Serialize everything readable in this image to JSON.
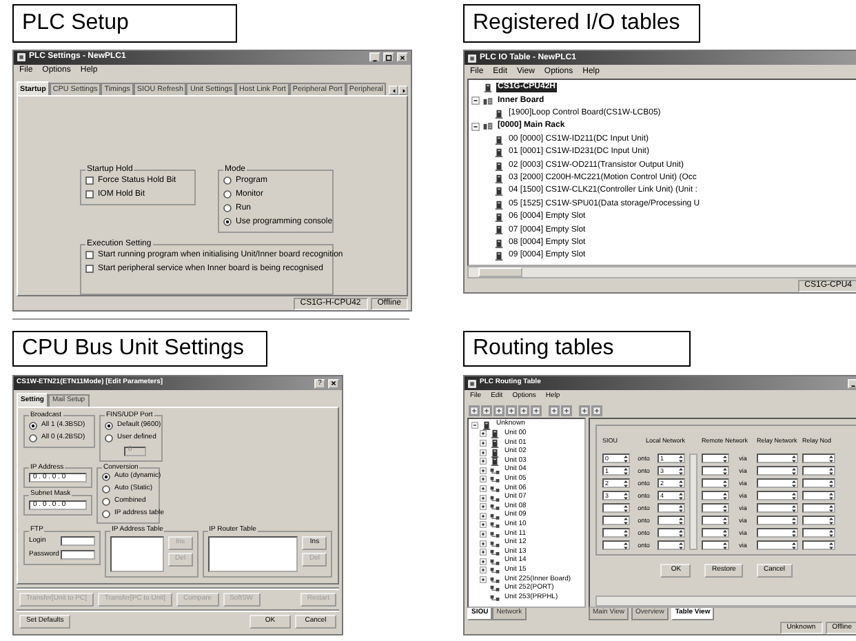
{
  "plc_setup": {
    "caption": "PLC Setup",
    "title": "PLC Settings - NewPLC1",
    "menu": [
      "File",
      "Options",
      "Help"
    ],
    "tabs": [
      {
        "label": "Startup",
        "selected": true
      },
      {
        "label": "CPU Settings",
        "selected": false
      },
      {
        "label": "Timings",
        "selected": false
      },
      {
        "label": "SIOU Refresh",
        "selected": false
      },
      {
        "label": "Unit Settings",
        "selected": false
      },
      {
        "label": "Host Link Port",
        "selected": false
      },
      {
        "label": "Peripheral Port",
        "selected": false
      },
      {
        "label": "Peripheral",
        "selected": false
      }
    ],
    "startup_hold": {
      "label": "Startup Hold",
      "items": [
        {
          "label": "Force Status Hold Bit",
          "checked": false
        },
        {
          "label": "IOM Hold Bit",
          "checked": false
        }
      ]
    },
    "mode": {
      "label": "Mode",
      "items": [
        {
          "label": "Program",
          "selected": false
        },
        {
          "label": "Monitor",
          "selected": false
        },
        {
          "label": "Run",
          "selected": false
        },
        {
          "label": "Use programming console",
          "selected": true
        }
      ]
    },
    "execution_setting": {
      "label": "Execution Setting",
      "items": [
        {
          "label": "Start running program when initialising Unit/Inner board recognition",
          "checked": false
        },
        {
          "label": "Start peripheral service when Inner board is being recognised",
          "checked": false
        }
      ]
    },
    "status_bar": [
      "CS1G-H-CPU42",
      "Offline"
    ]
  },
  "io_table": {
    "caption": "Registered I/O tables",
    "title": "PLC IO Table - NewPLC1",
    "menu": [
      "File",
      "Edit",
      "View",
      "Options",
      "Help"
    ],
    "tree": [
      {
        "label": "CS1G-CPU42H",
        "kind": "cpu",
        "selected": true
      },
      {
        "label": "Inner Board",
        "kind": "rack",
        "expanded": true,
        "selected": false,
        "children": [
          {
            "label": "[1900]Loop Control Board(CS1W-LCB05)",
            "kind": "unit",
            "selected": false
          }
        ]
      },
      {
        "label": "[0000] Main Rack",
        "kind": "rack",
        "expanded": true,
        "selected": false,
        "children": [
          {
            "label": "00 [0000] CS1W-ID211(DC Input Unit)",
            "kind": "unit",
            "selected": false
          },
          {
            "label": "01 [0001] CS1W-ID231(DC Input Unit)",
            "kind": "unit",
            "selected": false
          },
          {
            "label": "02 [0003] CS1W-OD211(Transistor Output Unit)",
            "kind": "unit",
            "selected": false
          },
          {
            "label": "03 [2000] C200H-MC221(Motion Control Unit) (Occ",
            "kind": "unit",
            "selected": false
          },
          {
            "label": "04 [1500] CS1W-CLK21(Controller Link Unit) (Unit :",
            "kind": "unit",
            "selected": false
          },
          {
            "label": "05 [1525] CS1W-SPU01(Data storage/Processing U",
            "kind": "unit",
            "selected": false
          },
          {
            "label": "06 [0004] Empty Slot",
            "kind": "unit",
            "selected": false
          },
          {
            "label": "07 [0004] Empty Slot",
            "kind": "unit",
            "selected": false
          },
          {
            "label": "08 [0004] Empty Slot",
            "kind": "unit",
            "selected": false
          },
          {
            "label": "09 [0004] Empty Slot",
            "kind": "unit",
            "selected": false
          }
        ]
      }
    ],
    "status_bar": [
      "CS1G-CPU4"
    ]
  },
  "cpu_bus_unit": {
    "caption": "CPU Bus Unit Settings",
    "title": "CS1W-ETN21(ETN11Mode) [Edit Parameters]",
    "help_button": "?",
    "tabs": [
      {
        "label": "Setting",
        "selected": true
      },
      {
        "label": "Mail Setup",
        "selected": false
      }
    ],
    "broadcast": {
      "label": "Broadcast",
      "items": [
        {
          "label": "All 1 (4.3BSD)",
          "selected": true
        },
        {
          "label": "All 0 (4.2BSD)",
          "selected": false
        }
      ]
    },
    "fins_udp_port": {
      "label": "FINS/UDP Port",
      "items": [
        {
          "label": "Default (9600)",
          "selected": true
        },
        {
          "label": "User defined",
          "selected": false
        }
      ],
      "field": {
        "value": "0",
        "disabled": true
      }
    },
    "ip_address": {
      "label": "IP Address",
      "value": "0 . 0 . 0 . 0"
    },
    "subnet_mask": {
      "label": "Subnet Mask",
      "value": "0 . 0 . 0 . 0"
    },
    "conversion": {
      "label": "Conversion",
      "items": [
        {
          "label": "Auto (dynamic)",
          "selected": true
        },
        {
          "label": "Auto (Static)",
          "selected": false
        },
        {
          "label": "Combined",
          "selected": false
        },
        {
          "label": "IP address table",
          "selected": false
        }
      ]
    },
    "ftp": {
      "label": "FTP",
      "fields": [
        "Login",
        "Password"
      ]
    },
    "ip_address_table": {
      "label": "IP Address Table",
      "buttons": [
        {
          "label": "Ins",
          "disabled": true
        },
        {
          "label": "Del",
          "disabled": true
        }
      ]
    },
    "ip_router_table": {
      "label": "IP Router Table",
      "buttons": [
        {
          "label": "Ins",
          "disabled": false
        },
        {
          "label": "Del",
          "disabled": true
        }
      ]
    },
    "transfer_buttons": [
      {
        "label": "Transfer[Unit to PC]",
        "disabled": true
      },
      {
        "label": "Transfer[PC to Unit]",
        "disabled": true
      },
      {
        "label": "Compare",
        "disabled": true
      },
      {
        "label": "SoftSW",
        "disabled": true
      }
    ],
    "restart_button": {
      "label": "Restart",
      "disabled": true
    },
    "footer_buttons": [
      {
        "label": "Set Defaults"
      },
      {
        "label": "OK"
      },
      {
        "label": "Cancel"
      }
    ]
  },
  "routing": {
    "caption": "Routing tables",
    "title": "PLC Routing Table",
    "menu": [
      "File",
      "Edit",
      "Options",
      "Help"
    ],
    "tree": [
      {
        "label": "Unknown",
        "kind": "plc",
        "expanded": true,
        "children": [
          {
            "label": "Unit 00",
            "kind": "plc",
            "expanded": false
          },
          {
            "label": "Unit 01",
            "kind": "plc",
            "expanded": false
          },
          {
            "label": "Unit 02",
            "kind": "plc",
            "expanded": false
          },
          {
            "label": "Unit 03",
            "kind": "plc",
            "expanded": false
          },
          {
            "label": "Unit 04",
            "kind": "network",
            "expanded": false
          },
          {
            "label": "Unit 05",
            "kind": "network",
            "expanded": false
          },
          {
            "label": "Unit 06",
            "kind": "network",
            "expanded": false
          },
          {
            "label": "Unit 07",
            "kind": "network",
            "expanded": false
          },
          {
            "label": "Unit 08",
            "kind": "network",
            "expanded": false
          },
          {
            "label": "Unit 09",
            "kind": "network",
            "expanded": false
          },
          {
            "label": "Unit 10",
            "kind": "network",
            "expanded": false
          },
          {
            "label": "Unit 11",
            "kind": "network",
            "expanded": false
          },
          {
            "label": "Unit 12",
            "kind": "network",
            "expanded": false
          },
          {
            "label": "Unit 13",
            "kind": "network",
            "expanded": false
          },
          {
            "label": "Unit 14",
            "kind": "network",
            "expanded": false
          },
          {
            "label": "Unit 15",
            "kind": "network",
            "expanded": false
          },
          {
            "label": "Unit 225(Inner Board)",
            "kind": "network",
            "expanded": false
          },
          {
            "label": "Unit 252(PORT)",
            "kind": "network"
          },
          {
            "label": "Unit 253(PRPHL)",
            "kind": "network"
          }
        ]
      }
    ],
    "left_tabs": [
      {
        "label": "SIOU",
        "selected": true
      },
      {
        "label": "Network",
        "selected": false
      }
    ],
    "headers": [
      "SIOU",
      "Local Network",
      "Remote Network",
      "Relay Network",
      "Relay Nod"
    ],
    "rows": [
      {
        "siou": "0",
        "onto": "onto",
        "local": "1",
        "via": "via"
      },
      {
        "siou": "1",
        "onto": "onto",
        "local": "3",
        "via": "via"
      },
      {
        "siou": "2",
        "onto": "onto",
        "local": "2",
        "via": "via"
      },
      {
        "siou": "3",
        "onto": "onto",
        "local": "4",
        "via": "via"
      },
      {
        "onto": "onto",
        "via": "via"
      },
      {
        "onto": "onto",
        "via": "via"
      },
      {
        "onto": "onto",
        "via": "via"
      },
      {
        "onto": "onto",
        "via": "via"
      }
    ],
    "buttons": [
      "OK",
      "Restore",
      "Cancel"
    ],
    "view_tabs": [
      {
        "label": "Main View",
        "selected": false
      },
      {
        "label": "Overview",
        "selected": false
      },
      {
        "label": "Table View",
        "selected": true
      }
    ],
    "status_bar": [
      "Unknown",
      "Offline"
    ]
  }
}
